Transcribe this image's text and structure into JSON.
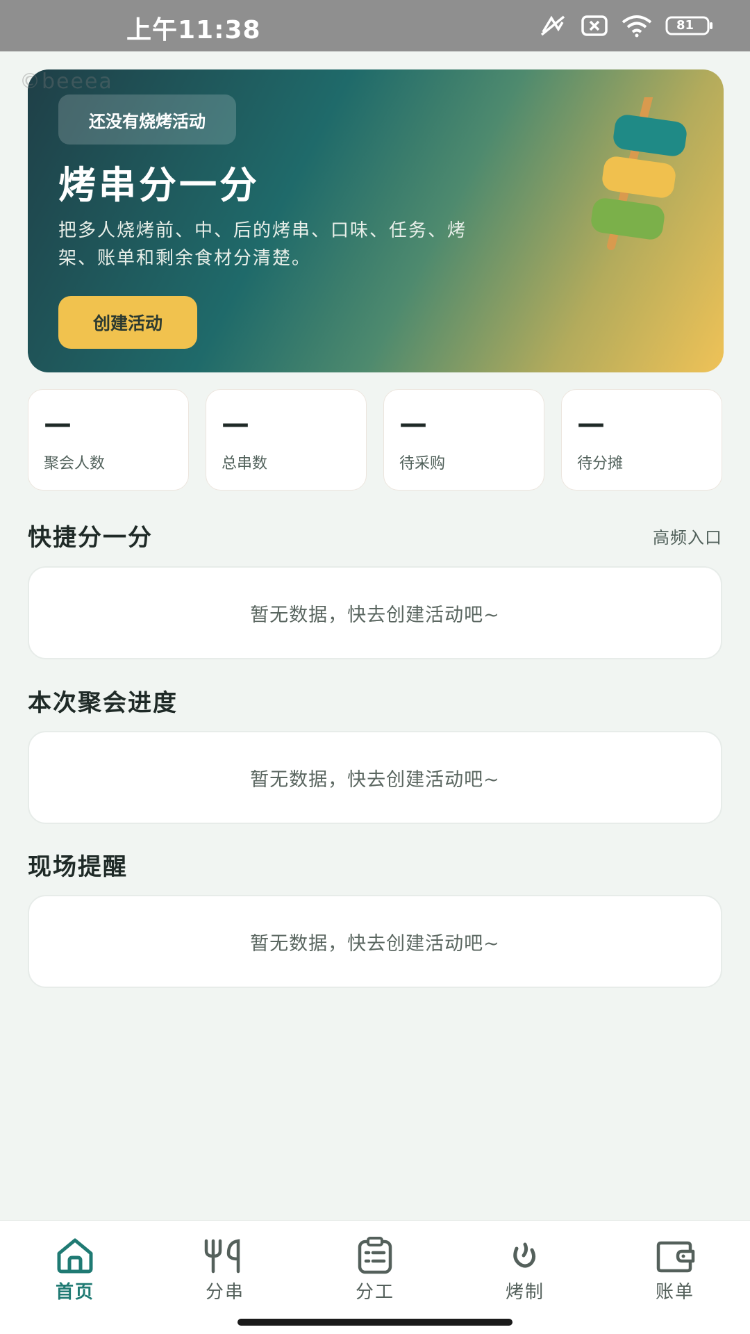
{
  "status_bar": {
    "time": "上午11:38",
    "battery": "81"
  },
  "watermark": "©beeea",
  "hero": {
    "badge": "还没有烧烤活动",
    "title": "烤串分一分",
    "description": "把多人烧烤前、中、后的烤串、口味、任务、烤架、账单和剩余食材分清楚。",
    "button_label": "创建活动"
  },
  "stats": [
    {
      "value": "—",
      "label": "聚会人数"
    },
    {
      "value": "—",
      "label": "总串数"
    },
    {
      "value": "—",
      "label": "待采购"
    },
    {
      "value": "—",
      "label": "待分摊"
    }
  ],
  "sections": {
    "quick": {
      "title": "快捷分一分",
      "link": "高频入口",
      "empty": "暂无数据，快去创建活动吧~"
    },
    "progress": {
      "title": "本次聚会进度",
      "empty": "暂无数据，快去创建活动吧~"
    },
    "reminder": {
      "title": "现场提醒",
      "empty": "暂无数据，快去创建活动吧~"
    }
  },
  "tabs": [
    {
      "label": "首页",
      "icon": "home-icon",
      "active": true
    },
    {
      "label": "分串",
      "icon": "fork-knife-icon",
      "active": false
    },
    {
      "label": "分工",
      "icon": "clipboard-icon",
      "active": false
    },
    {
      "label": "烤制",
      "icon": "flame-icon",
      "active": false
    },
    {
      "label": "账单",
      "icon": "wallet-icon",
      "active": false
    }
  ],
  "colors": {
    "accent": "#1f7a73",
    "button": "#f1c24e",
    "background": "#f1f5f2"
  }
}
